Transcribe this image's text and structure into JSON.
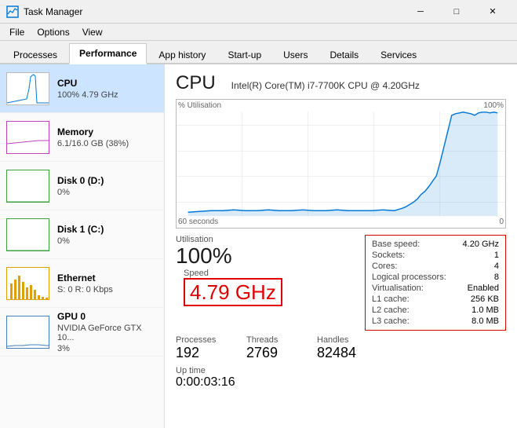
{
  "titlebar": {
    "title": "Task Manager",
    "min": "─",
    "max": "□",
    "close": "✕"
  },
  "menubar": {
    "items": [
      "File",
      "Options",
      "View"
    ]
  },
  "tabs": [
    {
      "label": "Processes",
      "active": false
    },
    {
      "label": "Performance",
      "active": true
    },
    {
      "label": "App history",
      "active": false
    },
    {
      "label": "Start-up",
      "active": false
    },
    {
      "label": "Users",
      "active": false
    },
    {
      "label": "Details",
      "active": false
    },
    {
      "label": "Services",
      "active": false
    }
  ],
  "sidebar": {
    "items": [
      {
        "name": "CPU",
        "detail": "100% 4.79 GHz",
        "type": "cpu",
        "active": true
      },
      {
        "name": "Memory",
        "detail": "6.1/16.0 GB (38%)",
        "type": "memory",
        "active": false
      },
      {
        "name": "Disk 0 (D:)",
        "detail": "0%",
        "type": "disk0",
        "active": false
      },
      {
        "name": "Disk 1 (C:)",
        "detail": "0%",
        "type": "disk1",
        "active": false
      },
      {
        "name": "Ethernet",
        "detail": "S: 0  R: 0 Kbps",
        "type": "ethernet",
        "active": false
      },
      {
        "name": "GPU 0",
        "detail": "NVIDIA GeForce GTX 10...\n3%",
        "type": "gpu",
        "active": false
      }
    ]
  },
  "panel": {
    "title": "CPU",
    "subtitle": "Intel(R) Core(TM) i7-7700K CPU @ 4.20GHz",
    "chart": {
      "y_label": "% Utilisation",
      "y_max": "100%",
      "x_left": "60 seconds",
      "x_right": "0"
    },
    "utilisation_label": "Utilisation",
    "utilisation_value": "100%",
    "speed_label": "Speed",
    "speed_value": "4.79 GHz",
    "processes_label": "Processes",
    "processes_value": "192",
    "threads_label": "Threads",
    "threads_value": "2769",
    "handles_label": "Handles",
    "handles_value": "82484",
    "uptime_label": "Up time",
    "uptime_value": "0:00:03:16",
    "info": {
      "base_speed_label": "Base speed:",
      "base_speed_value": "4.20 GHz",
      "sockets_label": "Sockets:",
      "sockets_value": "1",
      "cores_label": "Cores:",
      "cores_value": "4",
      "logical_label": "Logical processors:",
      "logical_value": "8",
      "virt_label": "Virtualisation:",
      "virt_value": "Enabled",
      "l1_label": "L1 cache:",
      "l1_value": "256 KB",
      "l2_label": "L2 cache:",
      "l2_value": "1.0 MB",
      "l3_label": "L3 cache:",
      "l3_value": "8.0 MB"
    }
  }
}
